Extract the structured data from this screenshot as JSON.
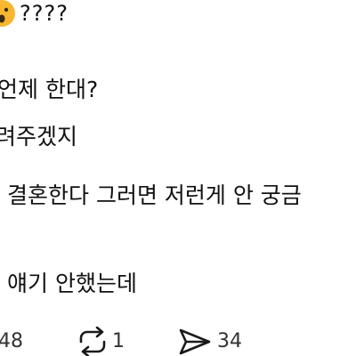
{
  "post": {
    "emoji": "astonished-face",
    "question_marks": "????",
    "lines": [
      "언제 한대?",
      "려주겠지",
      "결혼한다 그러면 저런게 안 궁금",
      "얘기 안했는데"
    ]
  },
  "actions": {
    "likes": "48",
    "reposts": "1",
    "shares": "34"
  },
  "colors": {
    "text": "#111111",
    "secondary": "#333333",
    "emoji_face": "#F7B731",
    "background": "#ffffff"
  }
}
